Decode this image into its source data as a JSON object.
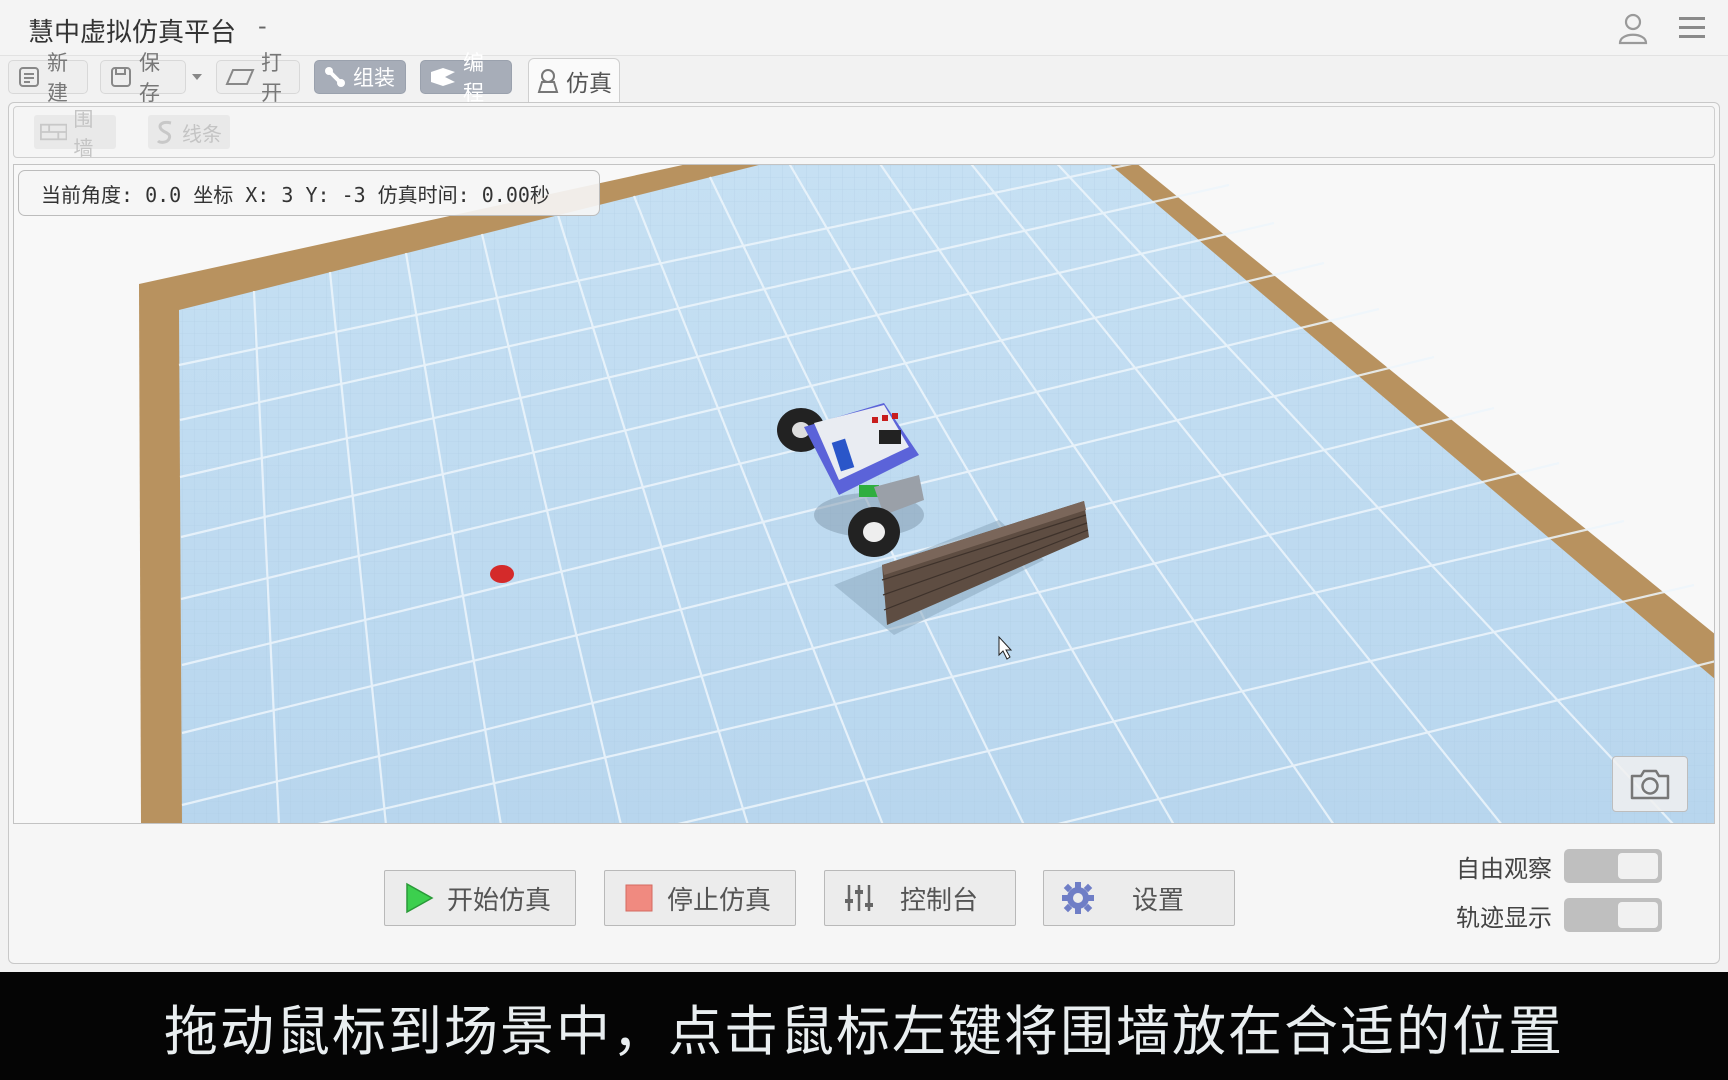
{
  "app": {
    "title": "慧中虚拟仿真平台",
    "title_suffix": "-"
  },
  "header": {
    "icons": [
      "user-icon",
      "menu-icon"
    ]
  },
  "toolbar": {
    "new_label": "新建",
    "save_label": "保存",
    "open_label": "打开",
    "assemble_label": "组装",
    "program_label": "编程",
    "simulate_label": "仿真"
  },
  "subtoolbar": {
    "wall_label": "围墙",
    "line_label": "线条"
  },
  "status": {
    "angle": "当前角度: 0.0",
    "coords": "坐标 X: 3 Y: -3",
    "sim_time": "仿真时间: 0.00秒"
  },
  "controls": {
    "start_label": "开始仿真",
    "stop_label": "停止仿真",
    "console_label": "控制台",
    "settings_label": "设置"
  },
  "toggles": {
    "free_view_label": "自由观察",
    "trail_label": "轨迹显示"
  },
  "caption": {
    "text": "拖动鼠标到场景中，点击鼠标左键将围墙放在合适的位置"
  },
  "colors": {
    "floor": "#bcdaf0",
    "border_wood": "#b8925f",
    "accent_button": "#a7adb8",
    "subtitle_bg": "#050505"
  }
}
